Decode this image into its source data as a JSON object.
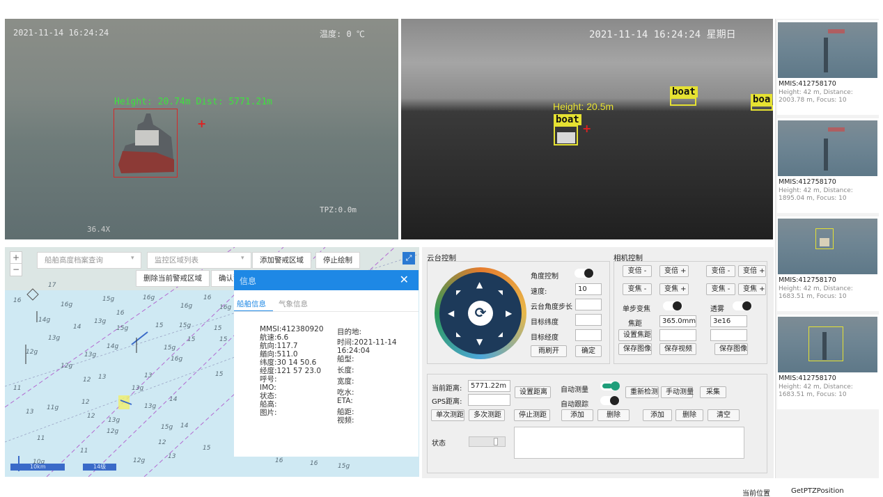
{
  "video_left": {
    "timestamp": "2021-11-14 16:24:24",
    "temp": "温度: 0 ℃",
    "measure": "Height: 20.74m Dist: 5771.21m",
    "ptz": "TPZ:0.0m",
    "bottom_text": "36.4X"
  },
  "video_right": {
    "timestamp": "2021-11-14 16:24:24 星期日",
    "height": "Height: 20.5m",
    "boat_labels": [
      "boat",
      "boat",
      "boa"
    ]
  },
  "thumbnails": [
    {
      "mmsi": "MMIS:412758170",
      "info": "Height: 42 m, Distance: 2003.78 m, Focus: 10"
    },
    {
      "mmsi": "MMIS:412758170",
      "info": "Height: 42 m, Distance: 1895.04 m, Focus: 10"
    },
    {
      "mmsi": "MMIS:412758170",
      "info": "Height: 42 m, Distance: 1683.51 m, Focus: 10"
    },
    {
      "mmsi": "MMIS:412758170",
      "info": "Height: 42 m, Distance: 1683.51 m, Focus: 10"
    }
  ],
  "map": {
    "search_placeholder": "船舶高度档案查询",
    "area_list_placeholder": "监控区域列表",
    "add_zone": "添加警戒区域",
    "stop_draw": "停止绘制",
    "delete_zone": "删除当前警戒区域",
    "confirm_zone": "确认警戒范围",
    "scale_label": "10km",
    "zoom_label": "14级",
    "depths": [
      "16",
      "16g",
      "17",
      "14g",
      "15g",
      "16g",
      "16g",
      "16",
      "16g",
      "16",
      "15",
      "13g",
      "15g",
      "15g",
      "14",
      "15",
      "12g",
      "13g",
      "14g",
      "15",
      "13g",
      "15",
      "12g",
      "15g",
      "16g",
      "11",
      "12",
      "13",
      "12",
      "13g",
      "13",
      "15",
      "13",
      "14",
      "11g",
      "12",
      "13g",
      "14",
      "11",
      "13g",
      "12g",
      "15g",
      "12",
      "11",
      "10g",
      "12g",
      "13",
      "15",
      "16",
      "16",
      "15g"
    ]
  },
  "ship_info": {
    "title": "信息",
    "tab_ship": "船舶信息",
    "tab_weather": "气象信息",
    "left": [
      "MMSI:412380920",
      "航速:6.6",
      "航向:117.7",
      "艏向:511.0",
      "纬度:30 14 50.6",
      "经度:121 57 23.0",
      "呼号:",
      "IMO:",
      "状态:",
      "船高:",
      "图片:"
    ],
    "right": [
      "目的地:",
      "时间:2021-11-14 16:24:04",
      "船型:",
      "长度:",
      "宽度:",
      "吃水:",
      "ETA:",
      "船距:",
      "视频:"
    ]
  },
  "ptz_control": {
    "title": "云台控制",
    "angle_control": "角度控制",
    "speed_label": "速度:",
    "speed_value": "10",
    "step_label": "云台角度步长",
    "target_lat": "目标纬度",
    "target_lon": "目标经度",
    "wiper": "雨刷开",
    "confirm": "确定"
  },
  "camera_control": {
    "title": "相机控制",
    "zoom_minus": "变倍 -",
    "zoom_plus": "变倍 +",
    "zoom_minus2": "变倍 -",
    "zoom_plus2": "变倍 +",
    "focus_minus": "变焦 -",
    "focus_plus": "变焦 +",
    "focus_minus2": "变焦 -",
    "focus_plus2": "变焦 +",
    "step_focus": "单步变焦",
    "defog": "透雾",
    "focal_label": "焦距",
    "focal_value": "365.0mm",
    "defog_value": "3e16",
    "set_focal": "设置焦距",
    "save_image": "保存图像",
    "save_video": "保存视频",
    "save_image2": "保存图像"
  },
  "measure": {
    "current_distance_label": "当前距离:",
    "current_distance_value": "5771.22m",
    "gps_distance_label": "GPS距离:",
    "set_distance": "设置距离",
    "auto_measure": "自动测量",
    "auto_track": "自动跟踪",
    "redetect": "重新检测",
    "manual_measure": "手动测量",
    "collect": "采集",
    "single": "单次测距",
    "multi": "多次测距",
    "stop": "停止测距",
    "add1": "添加",
    "delete1": "删除",
    "add2": "添加",
    "delete2": "删除",
    "clear": "清空",
    "status_label": "状态"
  },
  "footer": {
    "current_position": "当前位置",
    "command": "GetPTZPosition"
  },
  "colors": {
    "accent": "#1e88e5",
    "toggle_on": "#1e9e7a",
    "boat_box": "#e6e232",
    "target_box": "#d62828"
  }
}
